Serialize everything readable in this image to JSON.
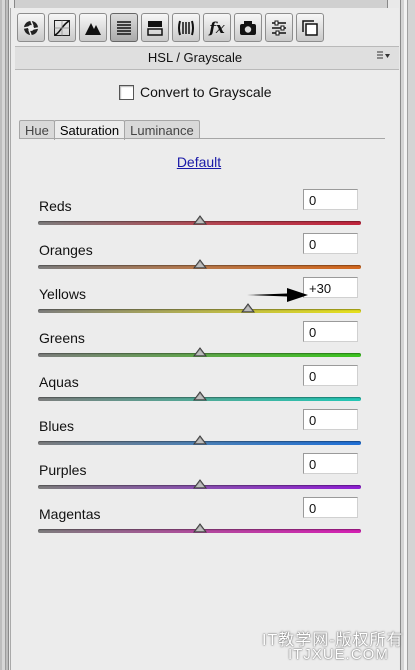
{
  "toolbar": {
    "tools": [
      {
        "icon": "aperture-icon"
      },
      {
        "icon": "tone-curve-icon"
      },
      {
        "icon": "detail-icon"
      },
      {
        "icon": "hsl-grayscale-icon",
        "active": true
      },
      {
        "icon": "split-toning-icon"
      },
      {
        "icon": "lens-corrections-icon"
      },
      {
        "label": "fx",
        "icon": "effects-icon"
      },
      {
        "icon": "camera-calibration-icon"
      },
      {
        "icon": "presets-icon"
      },
      {
        "icon": "snapshots-icon"
      }
    ]
  },
  "panel": {
    "title": "HSL / Grayscale",
    "menu_icon": "panel-menu-icon"
  },
  "convert": {
    "label": "Convert to Grayscale",
    "checked": false
  },
  "tabs": [
    {
      "label": "Hue",
      "active": false
    },
    {
      "label": "Saturation",
      "active": true
    },
    {
      "label": "Luminance",
      "active": false
    }
  ],
  "default_link": "Default",
  "sliders": [
    {
      "label": "Reds",
      "value": "0",
      "level": 0,
      "colors": [
        "#7d7d7d",
        "#b24a55",
        "#c0243c"
      ]
    },
    {
      "label": "Oranges",
      "value": "0",
      "level": 0,
      "colors": [
        "#7d7d7d",
        "#b8784a",
        "#d4681e"
      ]
    },
    {
      "label": "Yellows",
      "value": "+30",
      "level": 30,
      "colors": [
        "#7d7d7d",
        "#b5b24e",
        "#e6e01c"
      ]
    },
    {
      "label": "Greens",
      "value": "0",
      "level": 0,
      "colors": [
        "#7d7d7d",
        "#5fa64a",
        "#3bc41f"
      ]
    },
    {
      "label": "Aquas",
      "value": "0",
      "level": 0,
      "colors": [
        "#7d7d7d",
        "#4faa97",
        "#22c7b6"
      ]
    },
    {
      "label": "Blues",
      "value": "0",
      "level": 0,
      "colors": [
        "#7d7d7d",
        "#4a7fb5",
        "#1f6fd6"
      ]
    },
    {
      "label": "Purples",
      "value": "0",
      "level": 0,
      "colors": [
        "#7d7d7d",
        "#8a4fb0",
        "#8f1fd4"
      ]
    },
    {
      "label": "Magentas",
      "value": "0",
      "level": 0,
      "colors": [
        "#7d7d7d",
        "#b04a9c",
        "#d41fb2"
      ]
    }
  ],
  "watermark": {
    "line1": "IT教学网-版权所有",
    "line2": "ITJXUE.COM"
  }
}
